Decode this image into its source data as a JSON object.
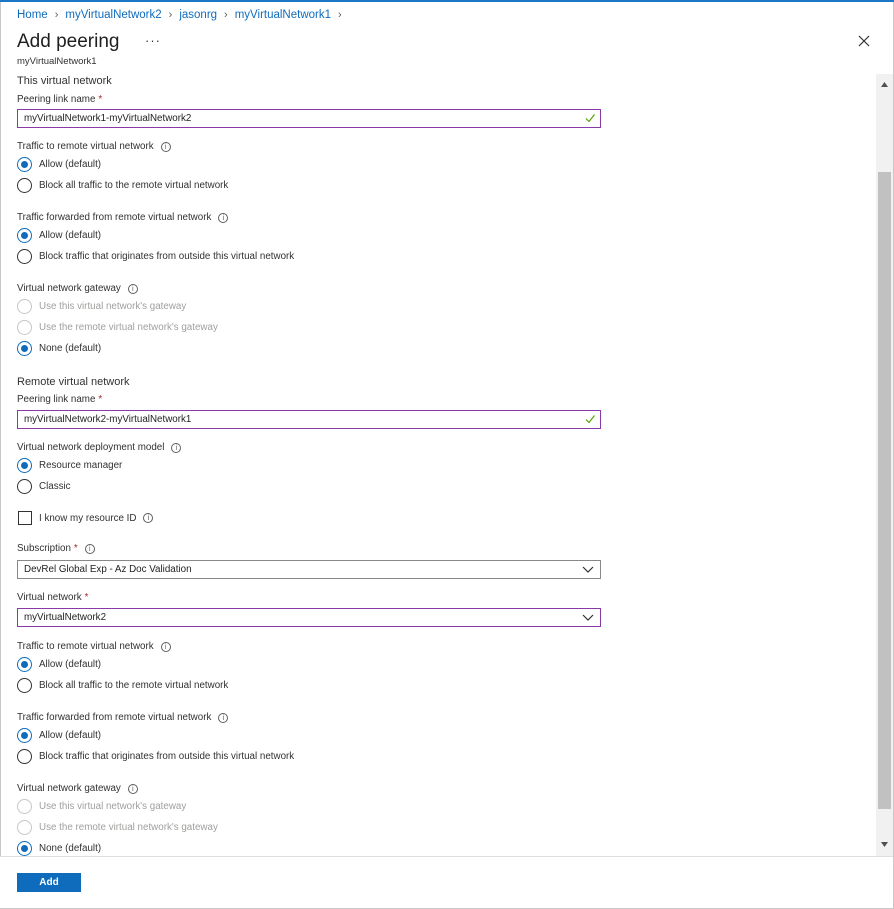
{
  "breadcrumb": [
    "Home",
    "myVirtualNetwork2",
    "jasonrg",
    "myVirtualNetwork1"
  ],
  "header": {
    "title": "Add peering",
    "more": "···",
    "subtitle": "myVirtualNetwork1"
  },
  "this_vnet": {
    "section_title": "This virtual network",
    "peering_link_label": "Peering link name",
    "peering_link_value": "myVirtualNetwork1-myVirtualNetwork2",
    "traffic_to_remote": {
      "label": "Traffic to remote virtual network",
      "options": [
        "Allow (default)",
        "Block all traffic to the remote virtual network"
      ],
      "selected": 0
    },
    "traffic_forwarded": {
      "label": "Traffic forwarded from remote virtual network",
      "options": [
        "Allow (default)",
        "Block traffic that originates from outside this virtual network"
      ],
      "selected": 0
    },
    "gateway": {
      "label": "Virtual network gateway",
      "options": [
        "Use this virtual network's gateway",
        "Use the remote virtual network's gateway",
        "None (default)"
      ],
      "selected": 2
    }
  },
  "remote_vnet": {
    "section_title": "Remote virtual network",
    "peering_link_label": "Peering link name",
    "peering_link_value": "myVirtualNetwork2-myVirtualNetwork1",
    "deployment_model": {
      "label": "Virtual network deployment model",
      "options": [
        "Resource manager",
        "Classic"
      ],
      "selected": 0
    },
    "know_resource_id_label": "I know my resource ID",
    "subscription_label": "Subscription",
    "subscription_value": "DevRel Global Exp - Az Doc Validation",
    "virtual_network_label": "Virtual network",
    "virtual_network_value": "myVirtualNetwork2",
    "traffic_to_remote": {
      "label": "Traffic to remote virtual network",
      "options": [
        "Allow (default)",
        "Block all traffic to the remote virtual network"
      ],
      "selected": 0
    },
    "traffic_forwarded": {
      "label": "Traffic forwarded from remote virtual network",
      "options": [
        "Allow (default)",
        "Block traffic that originates from outside this virtual network"
      ],
      "selected": 0
    },
    "gateway": {
      "label": "Virtual network gateway",
      "options": [
        "Use this virtual network's gateway",
        "Use the remote virtual network's gateway",
        "None (default)"
      ],
      "selected": 2
    }
  },
  "required_marker": "*",
  "info_glyph": "i",
  "footer": {
    "add_label": "Add"
  },
  "colors": {
    "accent": "#0f6cbd",
    "focus_border": "#8a3aa6",
    "valid_check": "#57a300",
    "required": "#a4262c"
  }
}
